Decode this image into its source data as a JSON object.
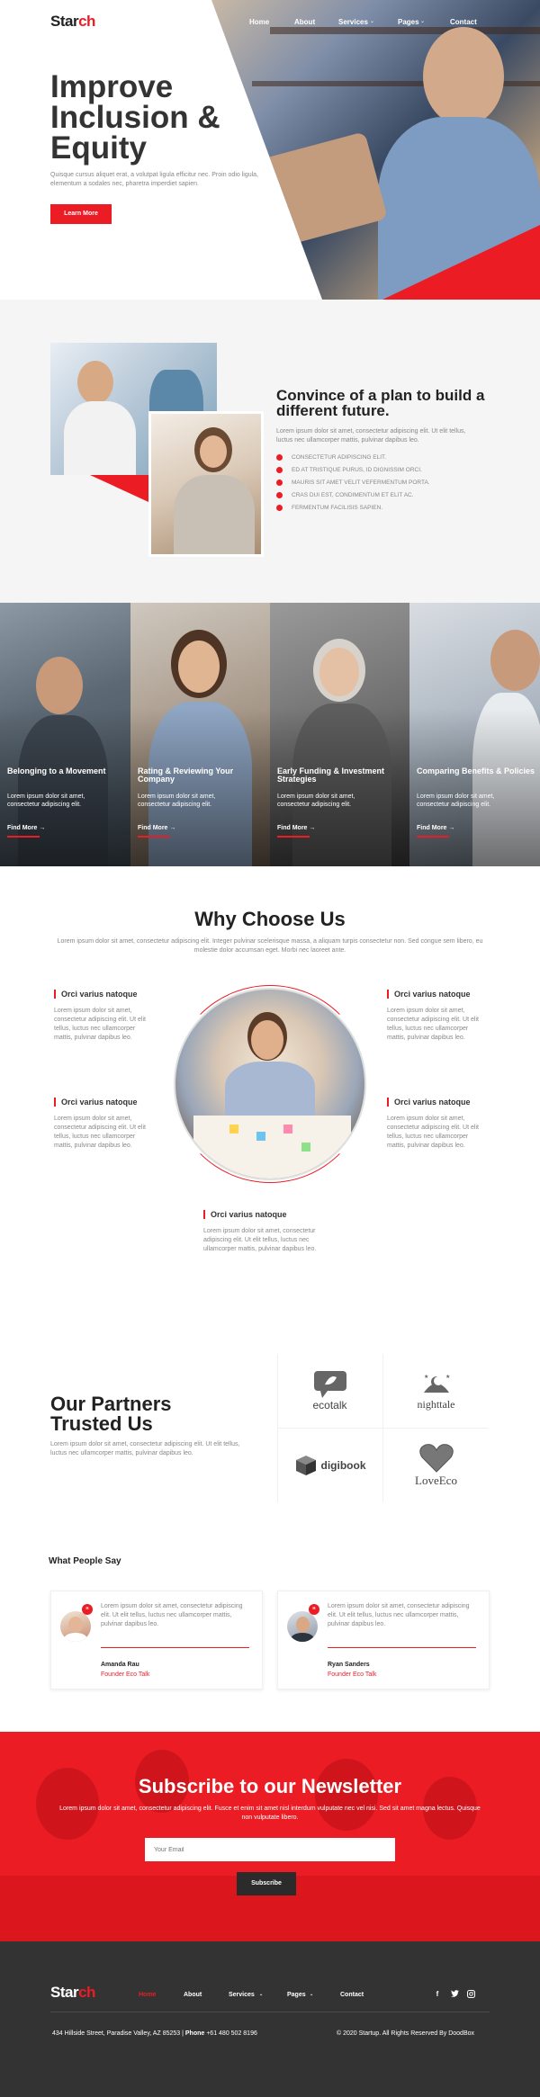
{
  "brand": {
    "part1": "Star",
    "part2": "ch"
  },
  "nav": {
    "items": [
      {
        "label": "Home"
      },
      {
        "label": "About"
      },
      {
        "label": "Services"
      },
      {
        "label": "Pages"
      },
      {
        "label": "Contact"
      }
    ]
  },
  "hero": {
    "title": "Improve Inclusion & Equity",
    "subtitle": "Quisque cursus aliquet erat, a volutpat ligula efficitur nec. Proin odio ligula, elementum a sodales nec, pharetra imperdiet sapien.",
    "button": "Learn More"
  },
  "plan": {
    "title": "Convince of a plan to build a different future.",
    "text": "Lorem ipsum dolor sit amet, consectetur adipiscing elit. Ut elit tellus, luctus nec ullamcorper mattis, pulvinar dapibus leo.",
    "checks": [
      "CONSECTETUR ADIPISCING ELIT.",
      "ED AT TRISTIQUE PURUS, ID DIGNISSIM ORCI.",
      "MAURIS SIT AMET VELIT VEFERMENTUM PORTA.",
      "CRAS DUI EST, CONDIMENTUM ET ELIT AC.",
      "FERMENTUM FACILISIS SAPIEN."
    ]
  },
  "team": [
    {
      "title": "Belonging to a Movement",
      "text": "Lorem ipsum dolor sit amet, consectetur adipiscing elit.",
      "link": "Find More"
    },
    {
      "title": "Rating & Reviewing Your Company",
      "text": "Lorem ipsum dolor sit amet, consectetur adipiscing elit.",
      "link": "Find More"
    },
    {
      "title": "Early Funding & Investment Strategies",
      "text": "Lorem ipsum dolor sit amet, consectetur adipiscing elit.",
      "link": "Find More"
    },
    {
      "title": "Comparing Benefits & Policies",
      "text": "Lorem ipsum dolor sit amet, consectetur adipiscing elit.",
      "link": "Find More"
    }
  ],
  "why": {
    "title": "Why Choose Us",
    "subtitle": "Lorem ipsum dolor sit amet, consectetur adipiscing elit. Integer pulvinar scelerisque massa, a aliquam turpis consectetur non. Sed congue sem libero, eu molestie dolor accumsan eget. Morbi nec laoreet ante.",
    "features": [
      {
        "title": "Orci varius natoque",
        "text": "Lorem ipsum dolor sit amet, consectetur adipiscing elit. Ut elit tellus, luctus nec ullamcorper mattis, pulvinar dapibus leo."
      },
      {
        "title": "Orci varius natoque",
        "text": "Lorem ipsum dolor sit amet, consectetur adipiscing elit. Ut elit tellus, luctus nec ullamcorper mattis, pulvinar dapibus leo."
      },
      {
        "title": "Orci varius natoque",
        "text": "Lorem ipsum dolor sit amet, consectetur adipiscing elit. Ut elit tellus, luctus nec ullamcorper mattis, pulvinar dapibus leo."
      },
      {
        "title": "Orci varius natoque",
        "text": "Lorem ipsum dolor sit amet, consectetur adipiscing elit. Ut elit tellus, luctus nec ullamcorper mattis, pulvinar dapibus leo."
      },
      {
        "title": "Orci varius natoque",
        "text": "Lorem ipsum dolor sit amet, consectetur adipiscing elit. Ut elit tellus, luctus nec ullamcorper mattis, pulvinar dapibus leo."
      }
    ]
  },
  "partners": {
    "title": "Our Partners Trusted Us",
    "text": "Lorem ipsum dolor sit amet, consectetur adipiscing elit. Ut elit tellus, luctus nec ullamcorper mattis, pulvinar dapibus leo.",
    "logos": [
      {
        "name": "ecotalk",
        "icon": "speech-bubble-icon"
      },
      {
        "name": "nighttale",
        "icon": "moon-stars-icon"
      },
      {
        "name": "digibook",
        "icon": "box-icon"
      },
      {
        "name": "LoveEco",
        "icon": "heart-icon"
      }
    ]
  },
  "testimonials": {
    "title": "What People Say",
    "items": [
      {
        "text": "Lorem ipsum dolor sit amet, consectetur adipiscing elit. Ut elit tellus, luctus nec ullamcorper mattis, pulvinar dapibus leo.",
        "name": "Amanda Rau",
        "role": "Founder Eco Talk"
      },
      {
        "text": "Lorem ipsum dolor sit amet, consectetur adipiscing elit. Ut elit tellus, luctus nec ullamcorper mattis, pulvinar dapibus leo.",
        "name": "Ryan Sanders",
        "role": "Founder Eco Talk"
      }
    ]
  },
  "newsletter": {
    "title": "Subscribe to our Newsletter",
    "text": "Lorem ipsum dolor sit amet, consectetur adipiscing elit. Fusce et enim sit amet nisl interdum vulputate nec vel nisi. Sed sit amet magna lectus. Quisque non vulputate libero.",
    "placeholder": "Your Email",
    "button": "Subscribe"
  },
  "footer": {
    "nav": [
      {
        "label": "Home"
      },
      {
        "label": "About"
      },
      {
        "label": "Services"
      },
      {
        "label": "Pages"
      },
      {
        "label": "Contact"
      }
    ],
    "address": "434 Hillside Street, Paradise Valley, AZ 85253",
    "phone_label": "Phone",
    "phone": "+61 480 502 8196",
    "copyright": "© 2020 Startup. All Rights Reserved By DoodBox",
    "social": [
      "facebook-icon",
      "twitter-icon",
      "instagram-icon"
    ]
  },
  "colors": {
    "accent": "#ec1c24",
    "dark": "#333333",
    "light_bg": "#f5f5f5"
  }
}
